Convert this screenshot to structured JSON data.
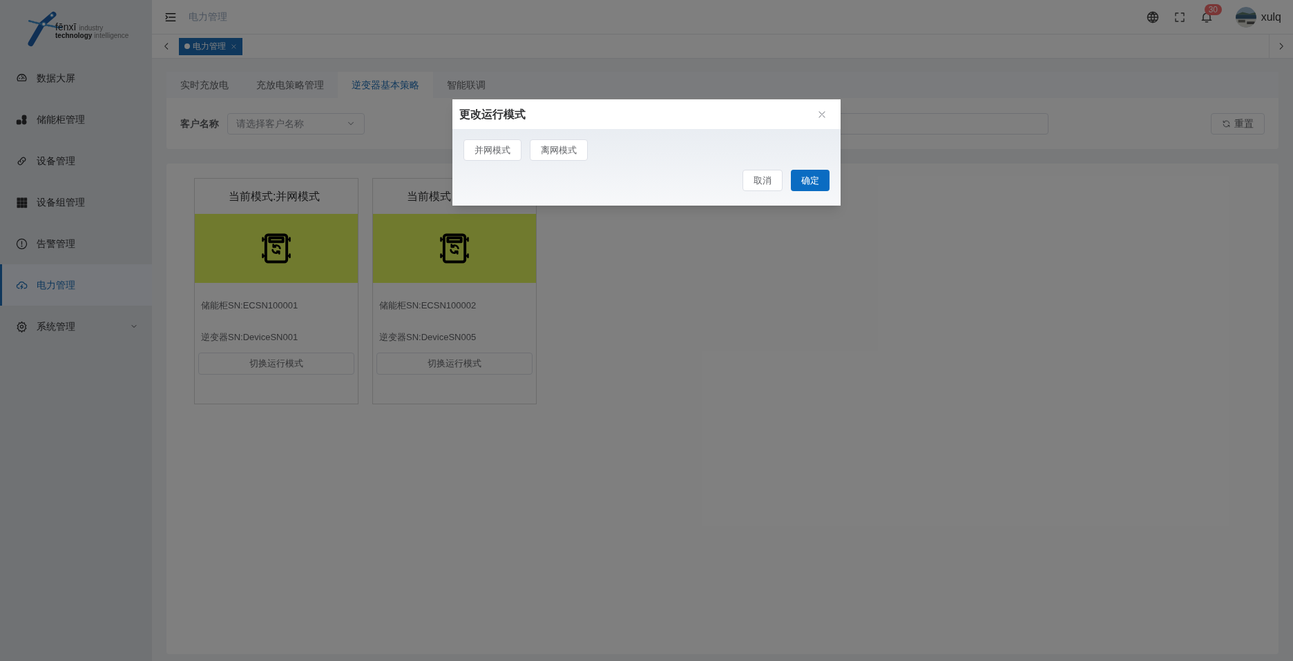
{
  "sidebar": {
    "logo": {
      "brand": "fēnxī",
      "line1": "industry",
      "line2_bold": "technology",
      "line2": "intelligence"
    },
    "items": [
      {
        "label": "数据大屏",
        "kind": "link",
        "selected": false
      },
      {
        "label": "储能柜管理",
        "kind": "link",
        "selected": false
      },
      {
        "label": "设备管理",
        "kind": "link",
        "selected": false
      },
      {
        "label": "设备组管理",
        "kind": "link",
        "selected": false
      },
      {
        "label": "告警管理",
        "kind": "link",
        "selected": false
      },
      {
        "label": "电力管理",
        "kind": "link",
        "selected": true
      },
      {
        "label": "系统管理",
        "kind": "group",
        "selected": false,
        "expanded": false
      }
    ]
  },
  "header": {
    "breadcrumb": "电力管理",
    "notification_count": "30",
    "user": "xulq"
  },
  "tag_bar": {
    "tags": [
      {
        "label": "电力管理",
        "selected": true
      }
    ]
  },
  "tabs": [
    {
      "label": "实时充放电",
      "selected": false
    },
    {
      "label": "充放电策略管理",
      "selected": false
    },
    {
      "label": "逆变器基本策略",
      "selected": true
    },
    {
      "label": "智能联调",
      "selected": false
    }
  ],
  "filter": {
    "label": "客户名称",
    "placeholder": "请选择客户名称",
    "reset_button": "重置"
  },
  "cards": [
    {
      "title": "当前模式:并网模式",
      "storage_sn": "储能柜SN:ECSN100001",
      "inverter_sn": "逆变器SN:DeviceSN001",
      "button": "切换运行模式"
    },
    {
      "title": "当前模式",
      "storage_sn": "储能柜SN:ECSN100002",
      "inverter_sn": "逆变器SN:DeviceSN005",
      "button": "切换运行模式"
    }
  ],
  "dialog": {
    "title": "更改运行模式",
    "options": [
      "并网模式",
      "离网模式"
    ],
    "cancel": "取消",
    "confirm": "确定"
  }
}
